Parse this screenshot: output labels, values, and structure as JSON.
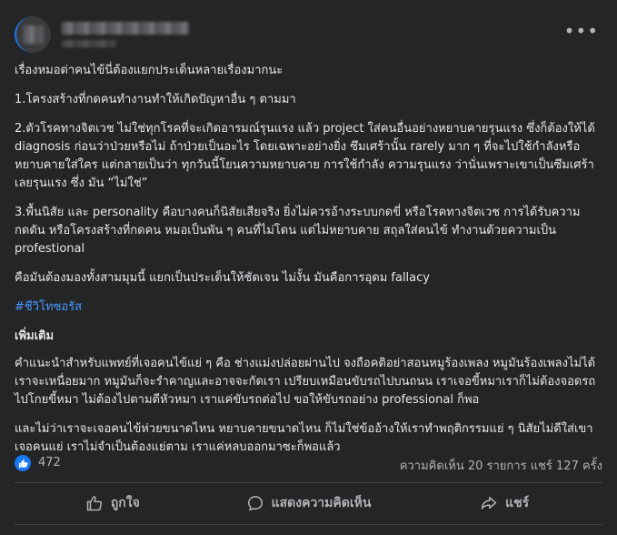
{
  "post": {
    "menu_icon": "more-horizontal-icon",
    "paragraphs": [
      "เรื่องหมอด่าคนไข้นี่ต้องแยกประเด็นหลายเรื่องมากนะ",
      "1.โครงสร้างที่กดคนทำงานทำให้เกิดปัญหาอื่น ๆ ตามมา",
      "2.ตัวโรคทางจิตเวช ไม่ใช่ทุกโรคที่จะเกิดอารมณ์รุนแรง แล้ว project ใส่คนอื่นอย่างหยาบคายรุนแรง ซึ่งก็ต้องให้ได้ diagnosis ก่อนว่าป่วยหรือไม่ ถ้าป่วยเป็นอะไร โดยเฉพาะอย่างยิ่ง ซึมเศร้านั้น rarely มาก ๆ ที่จะไปใช้กำลังหรือหยาบคายใส่ใคร แต่กลายเป็นว่า ทุกวันนี้โยนความหยาบคาย การใช้กำลัง ความรุนแรง ว่านั่นเพราะเขาเป็นซึมเศร้า เลยรุนแรง ซึ่ง มัน “ไม่ใช่”",
      "3.พื้นนิสัย และ personality คือบางคนก็นิสัยเสียจริง ยิ่งไม่ควรอ้างระบบกดขี่ หรือโรคทางจิตเวช การได้รับความกดดัน หรือโครงสร้างที่กดคน หมอเป็นพัน ๆ คนที่ไม่โดน แต่ไม่หยาบคาย สถุลใส่คนไข้ ทำงานด้วยความเป็น profestional",
      "คือมันต้องมองทั้งสามมุมนี้ แยกเป็นประเด็นให้ชัดเจน ไม่งั้น มันคือการอุดม fallacy"
    ],
    "hashtag": "#ชีวิโทซอรัส",
    "addendum_title": "เพิ่มเติม",
    "addendum_paragraphs": [
      "คำแนะนำสำหรับแพทย์ที่เจอคนไข้แย่ ๆ คือ ช่างแม่งปล่อยผ่านไป จงถือคติอย่าสอนหมูร้องเพลง หมูมันร้องเพลงไม่ได้ เราจะเหนื่อยมาก หมูมันก็จะรำคาญและอาจจะกัดเรา เปรียบเหมือนขับรถไปบนถนน เราเจอขี้หมาเราก็ไม่ต้องจอดรถไปโกยขี้หมา ไม่ต้องไปตามตีหัวหมา เราแค่ขับรถต่อไป ขอให้ขับรถอย่าง professional ก็พอ",
      "และไม่ว่าเราจะเจอคนไข้ห่วยขนาดไหน หยาบคายขนาดไหน ก็ไม่ใช่ข้ออ้างให้เราทำพฤติกรรมแย่ ๆ นิสัยไม่ดีใส่เขา เจอคนแย่ เราไม่จำเป็นต้องแย่ตาม เราแค่หลบออกมาซะก็พอแล้ว"
    ]
  },
  "stats": {
    "reaction_icon": "thumbs-up-icon",
    "like_count": "472",
    "comments_shares": "ความคิดเห็น 20 รายการ  แชร์ 127 ครั้ง"
  },
  "actions": {
    "like_label": "ถูกใจ",
    "comment_label": "แสดงความคิดเห็น",
    "share_label": "แชร์"
  },
  "colors": {
    "background": "#242526",
    "text": "#e4e6eb",
    "muted": "#b0b3b8",
    "hashtag": "#4599ff",
    "like_blue": "#1877f2"
  }
}
